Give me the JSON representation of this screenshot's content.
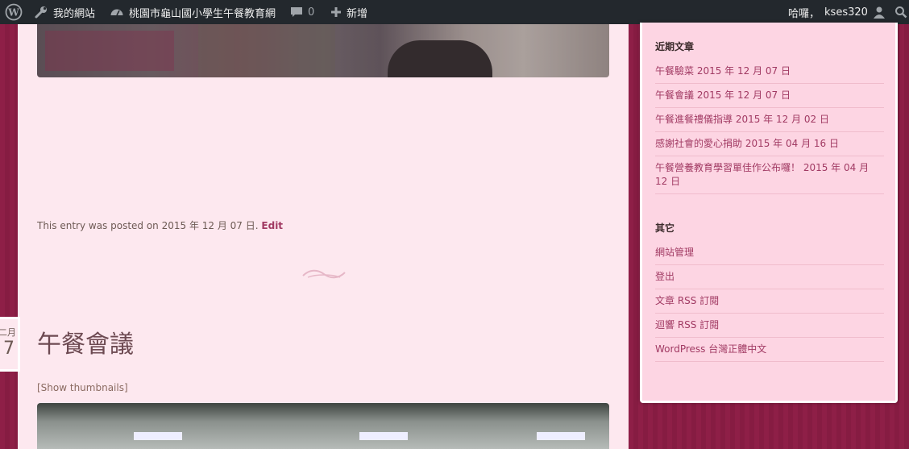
{
  "adminbar": {
    "my_sites": "我的網站",
    "site_name": "桃園市龜山國小學生午餐教育網",
    "comments_count": "0",
    "new_label": "新增",
    "greeting": "哈囉，",
    "username": "kses320"
  },
  "main": {
    "entry_meta_prefix": "This entry was posted on 2015 年 12 月 07 日.",
    "edit_label": "Edit",
    "date_badge_month": "二月",
    "date_badge_day": "7",
    "post_title": "午餐會議",
    "show_thumbnails": "[Show thumbnails]"
  },
  "sidebar": {
    "recent_title": "近期文章",
    "recent_posts": [
      "午餐驗菜 2015 年 12 月 07 日",
      "午餐會議 2015 年 12 月 07 日",
      "午餐進餐禮儀指導 2015 年 12 月 02 日",
      "感謝社會的愛心捐助 2015 年 04 月 16 日",
      "午餐營養教育學習單佳作公布囉！ 2015 年 04 月 12 日"
    ],
    "other_title": "其它",
    "other_links": [
      "網站管理",
      "登出",
      "文章 RSS 訂閱",
      "迴響 RSS 訂閱",
      "WordPress 台灣正體中文"
    ]
  },
  "colors": {
    "adminbar": "#23282d",
    "content_bg": "#fde8ef",
    "sidebar_bg": "#fdd5e3",
    "link": "#a13a63",
    "page_bg": "#8e1f47"
  }
}
